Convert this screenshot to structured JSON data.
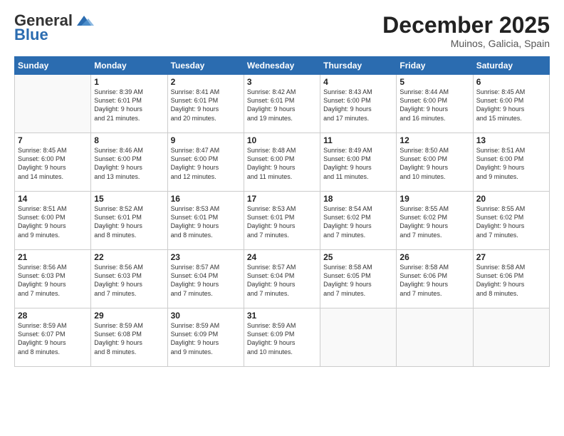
{
  "logo": {
    "general": "General",
    "blue": "Blue"
  },
  "header": {
    "month": "December 2025",
    "location": "Muinos, Galicia, Spain"
  },
  "days_of_week": [
    "Sunday",
    "Monday",
    "Tuesday",
    "Wednesday",
    "Thursday",
    "Friday",
    "Saturday"
  ],
  "weeks": [
    [
      {
        "day": "",
        "info": ""
      },
      {
        "day": "1",
        "info": "Sunrise: 8:39 AM\nSunset: 6:01 PM\nDaylight: 9 hours\nand 21 minutes."
      },
      {
        "day": "2",
        "info": "Sunrise: 8:41 AM\nSunset: 6:01 PM\nDaylight: 9 hours\nand 20 minutes."
      },
      {
        "day": "3",
        "info": "Sunrise: 8:42 AM\nSunset: 6:01 PM\nDaylight: 9 hours\nand 19 minutes."
      },
      {
        "day": "4",
        "info": "Sunrise: 8:43 AM\nSunset: 6:00 PM\nDaylight: 9 hours\nand 17 minutes."
      },
      {
        "day": "5",
        "info": "Sunrise: 8:44 AM\nSunset: 6:00 PM\nDaylight: 9 hours\nand 16 minutes."
      },
      {
        "day": "6",
        "info": "Sunrise: 8:45 AM\nSunset: 6:00 PM\nDaylight: 9 hours\nand 15 minutes."
      }
    ],
    [
      {
        "day": "7",
        "info": "Sunrise: 8:45 AM\nSunset: 6:00 PM\nDaylight: 9 hours\nand 14 minutes."
      },
      {
        "day": "8",
        "info": "Sunrise: 8:46 AM\nSunset: 6:00 PM\nDaylight: 9 hours\nand 13 minutes."
      },
      {
        "day": "9",
        "info": "Sunrise: 8:47 AM\nSunset: 6:00 PM\nDaylight: 9 hours\nand 12 minutes."
      },
      {
        "day": "10",
        "info": "Sunrise: 8:48 AM\nSunset: 6:00 PM\nDaylight: 9 hours\nand 11 minutes."
      },
      {
        "day": "11",
        "info": "Sunrise: 8:49 AM\nSunset: 6:00 PM\nDaylight: 9 hours\nand 11 minutes."
      },
      {
        "day": "12",
        "info": "Sunrise: 8:50 AM\nSunset: 6:00 PM\nDaylight: 9 hours\nand 10 minutes."
      },
      {
        "day": "13",
        "info": "Sunrise: 8:51 AM\nSunset: 6:00 PM\nDaylight: 9 hours\nand 9 minutes."
      }
    ],
    [
      {
        "day": "14",
        "info": "Sunrise: 8:51 AM\nSunset: 6:00 PM\nDaylight: 9 hours\nand 9 minutes."
      },
      {
        "day": "15",
        "info": "Sunrise: 8:52 AM\nSunset: 6:01 PM\nDaylight: 9 hours\nand 8 minutes."
      },
      {
        "day": "16",
        "info": "Sunrise: 8:53 AM\nSunset: 6:01 PM\nDaylight: 9 hours\nand 8 minutes."
      },
      {
        "day": "17",
        "info": "Sunrise: 8:53 AM\nSunset: 6:01 PM\nDaylight: 9 hours\nand 7 minutes."
      },
      {
        "day": "18",
        "info": "Sunrise: 8:54 AM\nSunset: 6:02 PM\nDaylight: 9 hours\nand 7 minutes."
      },
      {
        "day": "19",
        "info": "Sunrise: 8:55 AM\nSunset: 6:02 PM\nDaylight: 9 hours\nand 7 minutes."
      },
      {
        "day": "20",
        "info": "Sunrise: 8:55 AM\nSunset: 6:02 PM\nDaylight: 9 hours\nand 7 minutes."
      }
    ],
    [
      {
        "day": "21",
        "info": "Sunrise: 8:56 AM\nSunset: 6:03 PM\nDaylight: 9 hours\nand 7 minutes."
      },
      {
        "day": "22",
        "info": "Sunrise: 8:56 AM\nSunset: 6:03 PM\nDaylight: 9 hours\nand 7 minutes."
      },
      {
        "day": "23",
        "info": "Sunrise: 8:57 AM\nSunset: 6:04 PM\nDaylight: 9 hours\nand 7 minutes."
      },
      {
        "day": "24",
        "info": "Sunrise: 8:57 AM\nSunset: 6:04 PM\nDaylight: 9 hours\nand 7 minutes."
      },
      {
        "day": "25",
        "info": "Sunrise: 8:58 AM\nSunset: 6:05 PM\nDaylight: 9 hours\nand 7 minutes."
      },
      {
        "day": "26",
        "info": "Sunrise: 8:58 AM\nSunset: 6:06 PM\nDaylight: 9 hours\nand 7 minutes."
      },
      {
        "day": "27",
        "info": "Sunrise: 8:58 AM\nSunset: 6:06 PM\nDaylight: 9 hours\nand 8 minutes."
      }
    ],
    [
      {
        "day": "28",
        "info": "Sunrise: 8:59 AM\nSunset: 6:07 PM\nDaylight: 9 hours\nand 8 minutes."
      },
      {
        "day": "29",
        "info": "Sunrise: 8:59 AM\nSunset: 6:08 PM\nDaylight: 9 hours\nand 8 minutes."
      },
      {
        "day": "30",
        "info": "Sunrise: 8:59 AM\nSunset: 6:09 PM\nDaylight: 9 hours\nand 9 minutes."
      },
      {
        "day": "31",
        "info": "Sunrise: 8:59 AM\nSunset: 6:09 PM\nDaylight: 9 hours\nand 10 minutes."
      },
      {
        "day": "",
        "info": ""
      },
      {
        "day": "",
        "info": ""
      },
      {
        "day": "",
        "info": ""
      }
    ]
  ]
}
